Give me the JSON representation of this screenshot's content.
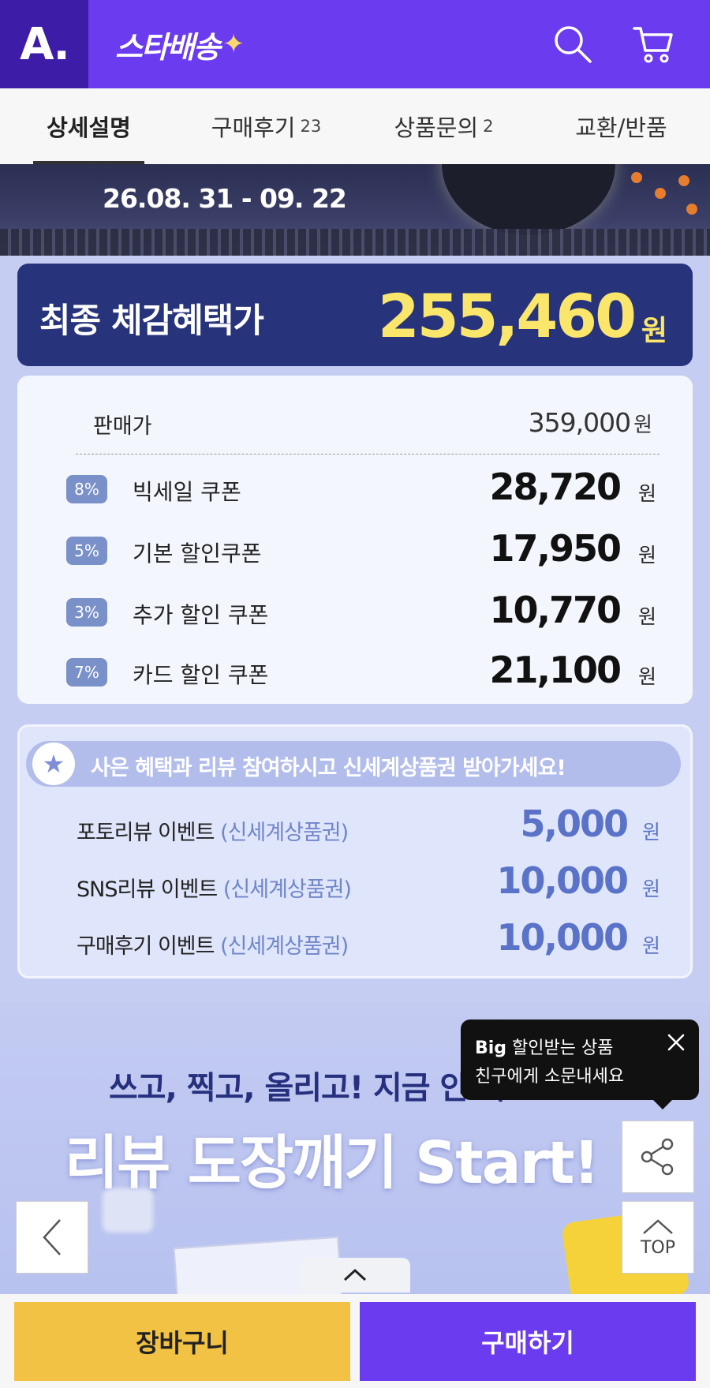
{
  "header": {
    "logo": "A.",
    "brand": "스타배송",
    "icons": [
      "search-icon",
      "cart-icon"
    ]
  },
  "tabs": [
    {
      "label": "상세설명",
      "count": ""
    },
    {
      "label": "구매후기",
      "count": "23"
    },
    {
      "label": "상품문의",
      "count": "2"
    },
    {
      "label": "교환/반품",
      "count": ""
    }
  ],
  "banner": {
    "date": "26.08. 31 - 09. 22"
  },
  "final_price": {
    "label": "최종 체감혜택가",
    "amount": "255,460",
    "unit": "원"
  },
  "discount": {
    "sale_label": "판매가",
    "sale_value": "359,000",
    "unit": "원",
    "coupons": [
      {
        "pct": "8%",
        "name": "빅세일 쿠폰",
        "amount": "28,720"
      },
      {
        "pct": "5%",
        "name": "기본 할인쿠폰",
        "amount": "17,950"
      },
      {
        "pct": "3%",
        "name": "추가 할인 쿠폰",
        "amount": "10,770"
      },
      {
        "pct": "7%",
        "name": "카드 할인 쿠폰",
        "amount": "21,100"
      }
    ]
  },
  "event": {
    "headline": "사은 혜택과 리뷰 참여하시고 신세계상품권 받아가세요!",
    "paren": "(신세계상품권)",
    "unit": "원",
    "rows": [
      {
        "name": "포토리뷰 이벤트",
        "amount": "5,000"
      },
      {
        "name": "SNS리뷰 이벤트",
        "amount": "10,000"
      },
      {
        "name": "구매후기 이벤트",
        "amount": "10,000"
      }
    ]
  },
  "review_banner": {
    "sub": "쓰고, 찍고, 올리고! 지금 안 하",
    "big": "리뷰 도장깨기 Start!"
  },
  "tooltip": {
    "bold": "Big",
    "line1_rest": " 할인받는 상품",
    "line2": "친구에게 소문내세요"
  },
  "floating": {
    "top_label": "TOP"
  },
  "bottom": {
    "cart_label": "장바구니",
    "buy_label": "구매하기"
  },
  "colors": {
    "brand_purple": "#6a3bef",
    "logo_dark": "#3d1ca8",
    "price_yellow": "#fbe66c",
    "final_box": "#27337a",
    "cart_yellow": "#f2c244",
    "coupon_badge": "#7a90c9",
    "event_blue": "#5a73c8"
  }
}
